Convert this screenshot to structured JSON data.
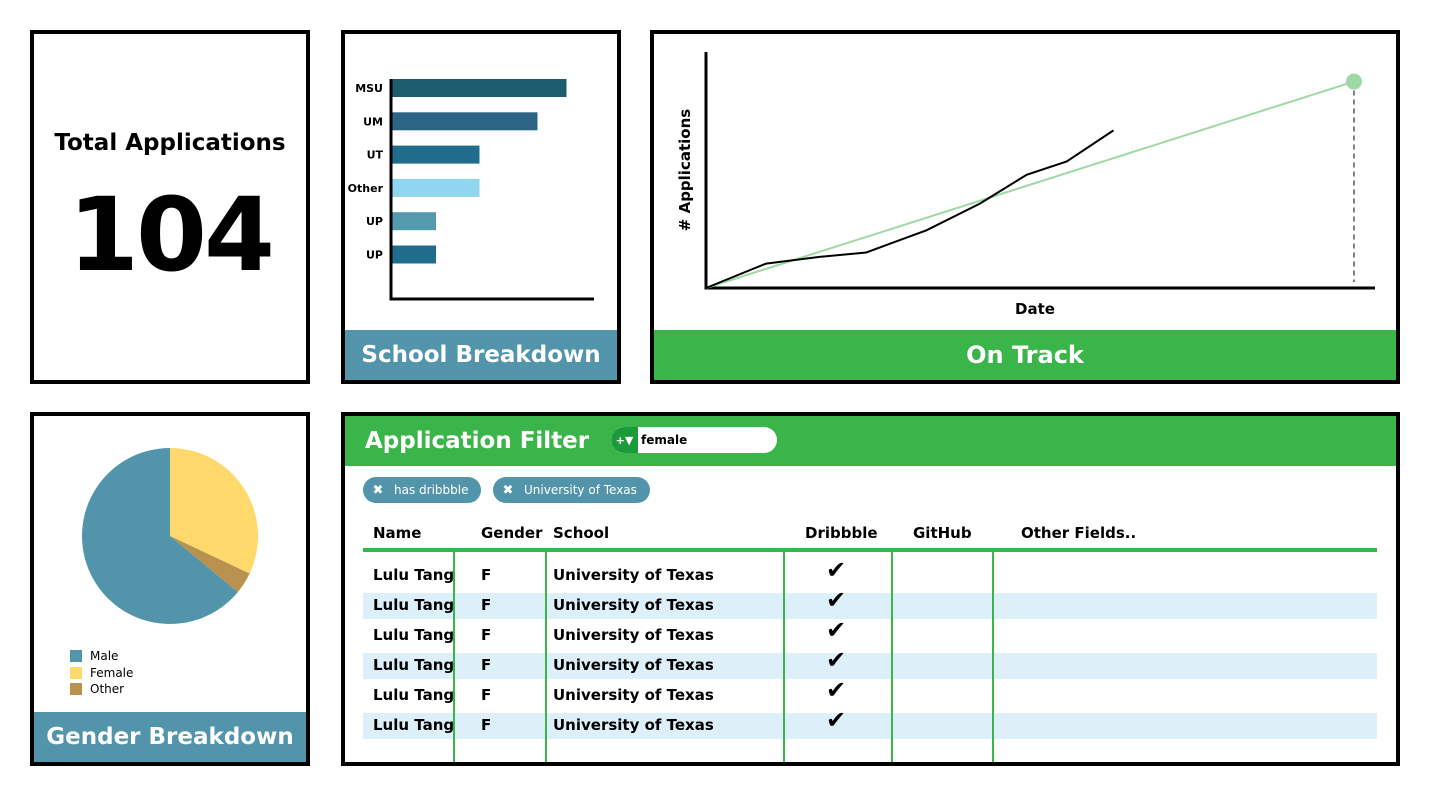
{
  "total": {
    "label": "Total Applications",
    "value": "104"
  },
  "school": {
    "title": "School Breakdown",
    "chart_data": {
      "type": "bar",
      "orientation": "horizontal",
      "categories": [
        "MSU",
        "UM",
        "UT",
        "Other",
        "UP",
        "UP"
      ],
      "values": [
        30,
        25,
        15,
        15,
        7.5,
        7.5
      ],
      "colors": [
        "#1c5c6c",
        "#2c6484",
        "#1f6c8c",
        "#8fd6f0",
        "#5599ac",
        "#1f6c8c"
      ],
      "xlim": [
        0,
        35
      ],
      "grid": false
    }
  },
  "ontrack": {
    "title": "On Track",
    "chart_data": {
      "type": "line",
      "xlabel": "Date",
      "ylabel": "# Applications",
      "xlim": [
        0,
        100
      ],
      "ylim": [
        0,
        100
      ],
      "grid": false,
      "series": [
        {
          "x": [
            0,
            9,
            17,
            24,
            33,
            41,
            48,
            54,
            61
          ],
          "y": [
            0,
            11,
            14,
            16,
            26,
            38,
            51,
            57,
            71
          ],
          "color": "#000000"
        },
        {
          "x": [
            0,
            97
          ],
          "y": [
            0,
            93
          ],
          "color": "#9ed8a4"
        }
      ],
      "target_marker": {
        "x": 97,
        "y": 93,
        "color": "#9ed8a4"
      }
    }
  },
  "gender": {
    "title": "Gender Breakdown",
    "chart_data": {
      "type": "pie",
      "categories": [
        "Male",
        "Female",
        "Other"
      ],
      "values": [
        64,
        32,
        4
      ],
      "colors": [
        "#5295aa",
        "#ffd96b",
        "#b8924e"
      ]
    },
    "legend": [
      {
        "label": "Male",
        "color": "#5295aa"
      },
      {
        "label": "Female",
        "color": "#ffd96b"
      },
      {
        "label": "Other",
        "color": "#b8924e"
      }
    ]
  },
  "filter": {
    "title": "Application Filter",
    "search": {
      "value": "female",
      "icon": "filter-icon"
    },
    "chips": [
      {
        "label": "has dribbble"
      },
      {
        "label": "University of Texas"
      }
    ],
    "columns": [
      "Name",
      "Gender",
      "School",
      "Dribbble",
      "GitHub",
      "Other Fields.."
    ],
    "rows": [
      {
        "name": "Lulu Tang",
        "gender": "F",
        "school": "University of Texas",
        "dribbble": true
      },
      {
        "name": "Lulu Tang",
        "gender": "F",
        "school": "University of Texas",
        "dribbble": true
      },
      {
        "name": "Lulu Tang",
        "gender": "F",
        "school": "University of Texas",
        "dribbble": true
      },
      {
        "name": "Lulu Tang",
        "gender": "F",
        "school": "University of Texas",
        "dribbble": true
      },
      {
        "name": "Lulu Tang",
        "gender": "F",
        "school": "University of Texas",
        "dribbble": true
      },
      {
        "name": "Lulu Tang",
        "gender": "F",
        "school": "University of Texas",
        "dribbble": true
      }
    ],
    "accent": "#3ab54a",
    "band_color": "#ddf0fa"
  }
}
